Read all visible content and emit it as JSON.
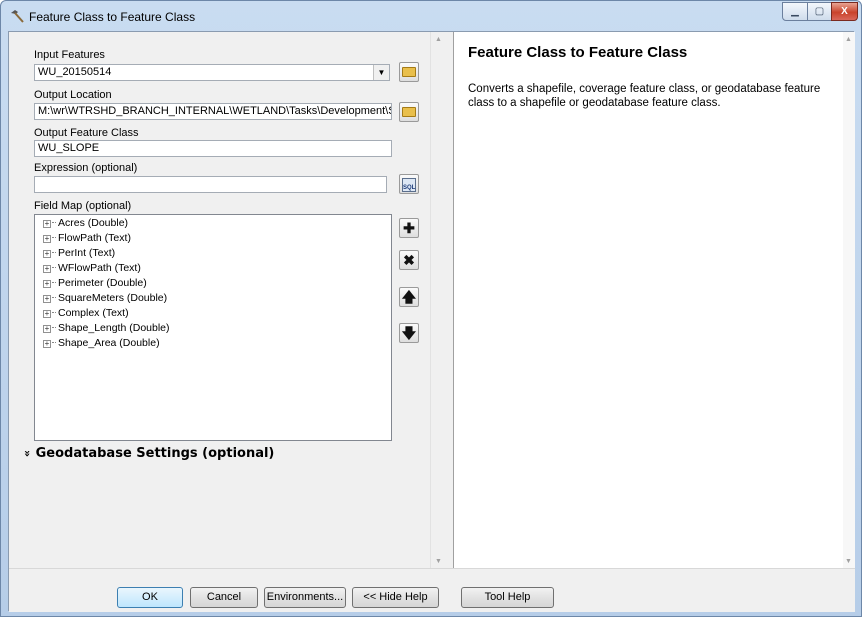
{
  "window": {
    "title": "Feature Class to Feature Class",
    "icon": "hammer-icon",
    "minimize_label": "▁",
    "maximize_label": "▢",
    "close_label": "X"
  },
  "form": {
    "input_features_label": "Input Features",
    "input_features_value": "WU_20150514",
    "output_location_label": "Output Location",
    "output_location_value": "M:\\wr\\WTRSHD_BRANCH_INTERNAL\\WETLAND\\Tasks\\Development\\SLOPE.gdb",
    "output_feature_class_label": "Output Feature Class",
    "output_feature_class_value": "WU_SLOPE",
    "expression_label": "Expression (optional)",
    "expression_value": "",
    "sql_button_label": "SQL",
    "field_map_label": "Field Map (optional)",
    "field_map_items": [
      "Acres (Double)",
      "FlowPath (Text)",
      "PerInt (Text)",
      "WFlowPath (Text)",
      "Perimeter (Double)",
      "SquareMeters (Double)",
      "Complex (Text)",
      "Shape_Length (Double)",
      "Shape_Area (Double)"
    ],
    "geodatabase_settings_label": "Geodatabase Settings (optional)",
    "geodatabase_chevron": "»"
  },
  "help": {
    "title": "Feature Class to Feature Class",
    "description": "Converts a shapefile, coverage feature class, or geodatabase feature class to a shapefile or geodatabase feature class."
  },
  "buttons": {
    "ok": "OK",
    "cancel": "Cancel",
    "environments": "Environments...",
    "hide_help": "<< Hide Help",
    "tool_help": "Tool Help"
  },
  "colors": {
    "title_bar": "#c9dcf1",
    "close_button": "#c9432b",
    "dialog_background": "#f0f0f0"
  }
}
